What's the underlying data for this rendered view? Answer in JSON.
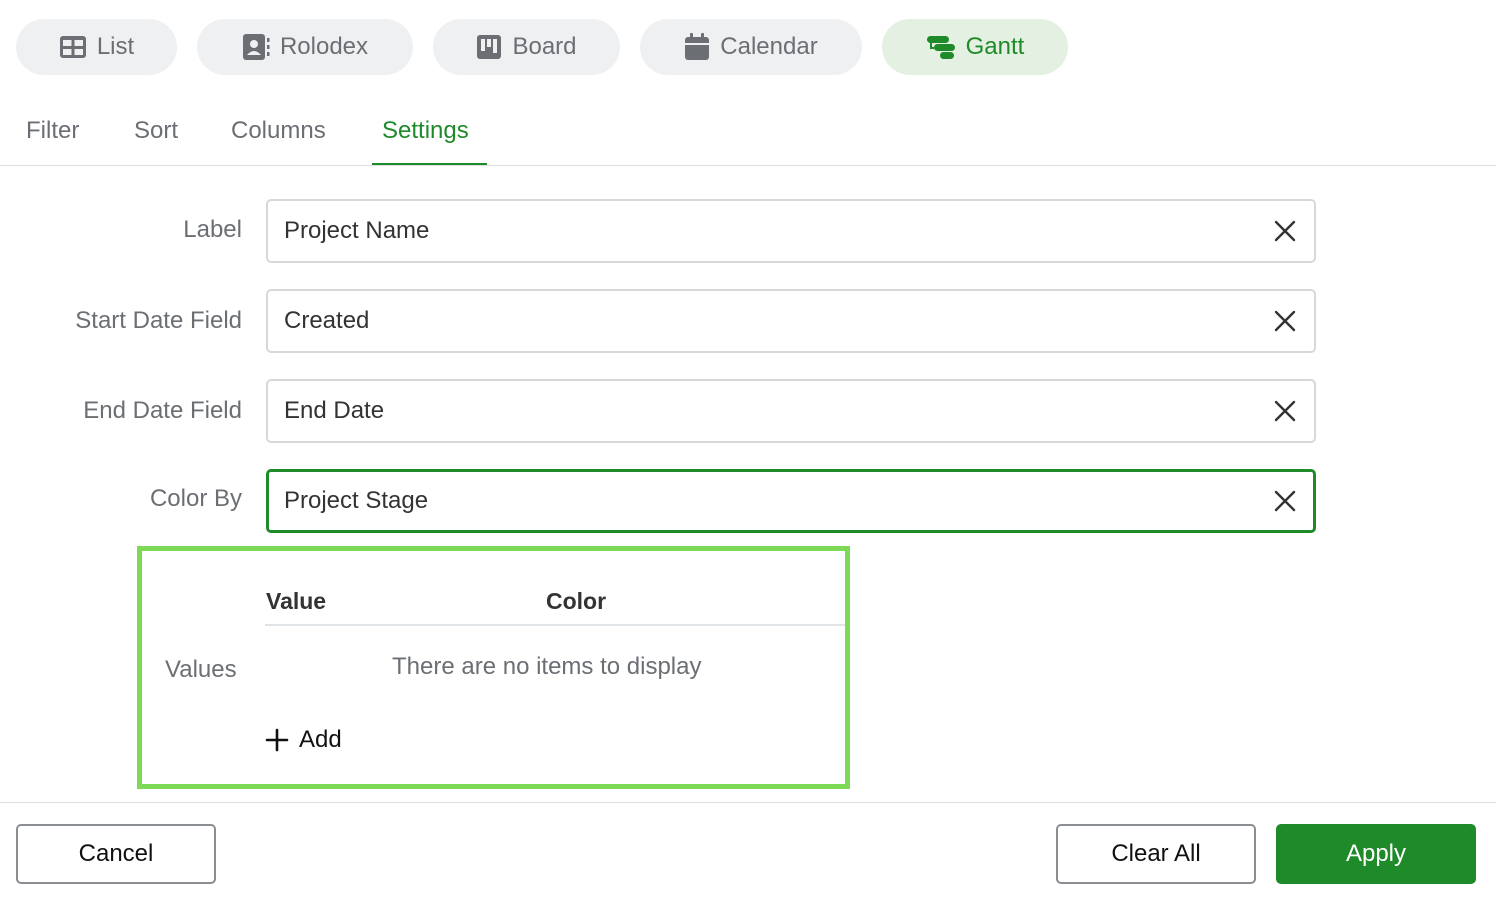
{
  "views": [
    {
      "label": "List",
      "icon": "table-icon",
      "active": false
    },
    {
      "label": "Rolodex",
      "icon": "contact-card-icon",
      "active": false
    },
    {
      "label": "Board",
      "icon": "kanban-board-icon",
      "active": false
    },
    {
      "label": "Calendar",
      "icon": "calendar-icon",
      "active": false
    },
    {
      "label": "Gantt",
      "icon": "gantt-icon",
      "active": true
    }
  ],
  "tabs": [
    {
      "label": "Filter",
      "active": false
    },
    {
      "label": "Sort",
      "active": false
    },
    {
      "label": "Columns",
      "active": false
    },
    {
      "label": "Settings",
      "active": true
    }
  ],
  "form": {
    "label": {
      "label": "Label",
      "value": "Project Name"
    },
    "start_date": {
      "label": "Start Date Field",
      "value": "Created"
    },
    "end_date": {
      "label": "End Date Field",
      "value": "End Date"
    },
    "color_by": {
      "label": "Color By",
      "value": "Project Stage",
      "focused": true
    }
  },
  "values": {
    "label": "Values",
    "columns": [
      "Value",
      "Color"
    ],
    "empty_message": "There are no items to display",
    "add_label": "Add"
  },
  "footer": {
    "cancel_label": "Cancel",
    "clear_all_label": "Clear All",
    "apply_label": "Apply"
  },
  "colors": {
    "accent": "#1f8a2a",
    "accent_bg": "#e4f1e2",
    "highlight_border": "#7ed957",
    "pill_bg": "#eef0f2"
  }
}
